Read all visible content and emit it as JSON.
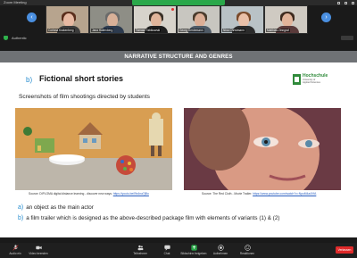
{
  "window": {
    "title": "Zoom Meeting"
  },
  "gallery": {
    "participants": [
      {
        "name": "Corinna Krakenberg"
      },
      {
        "name": "Jana Hallenberg"
      },
      {
        "name": "Tomasz Tabikowski"
      },
      {
        "name": "Georg Gerdemann"
      },
      {
        "name": "Nina Christmann"
      },
      {
        "name": "Matthias Zinngraf"
      }
    ]
  },
  "info": {
    "text": "Authentic"
  },
  "slide": {
    "header": "NARRATIVE STRUCTURE AND GENRES",
    "section_letter": "b)",
    "section_title": "Fictional short stories",
    "logo": {
      "line1": "Hochschule",
      "line2": "University of",
      "line3": "Applied Sciences"
    },
    "subtitle": "Screenshots of film shootings directed by students",
    "caption1": {
      "text": "Source: DIPLOMA digital distance learning - discover new ways: ",
      "link": "https://youtu.be/l9x4na7j8lo"
    },
    "caption2": {
      "text": "Source: The Red Cloth - Movie Trailer: ",
      "link": "https://www.youtube.com/watch?v=NpoM4a4VfA"
    },
    "items": [
      {
        "letter": "a)",
        "text": "an object as the main actor"
      },
      {
        "letter": "b)",
        "text": "a film trailer which is designed as the above-described package film with elements of variants (1) & (2)"
      }
    ]
  },
  "toolbar": {
    "buttons": [
      {
        "label": "Audio ein",
        "icon": "microphone-icon"
      },
      {
        "label": "Video beenden",
        "icon": "video-camera-icon"
      },
      {
        "label": "Teilnehmer",
        "icon": "participants-icon"
      },
      {
        "label": "Chat",
        "icon": "chat-icon"
      },
      {
        "label": "Bildschirm freigeben",
        "icon": "share-screen-icon"
      },
      {
        "label": "Aufnehmen",
        "icon": "record-icon"
      },
      {
        "label": "Reaktionen",
        "icon": "reactions-icon"
      }
    ],
    "end_label": "Verlassen"
  },
  "colors": {
    "accent": "#2a8fd0",
    "share_green": "#2aa84a",
    "end_red": "#e02a2a",
    "slide_header": "#6f7275"
  }
}
